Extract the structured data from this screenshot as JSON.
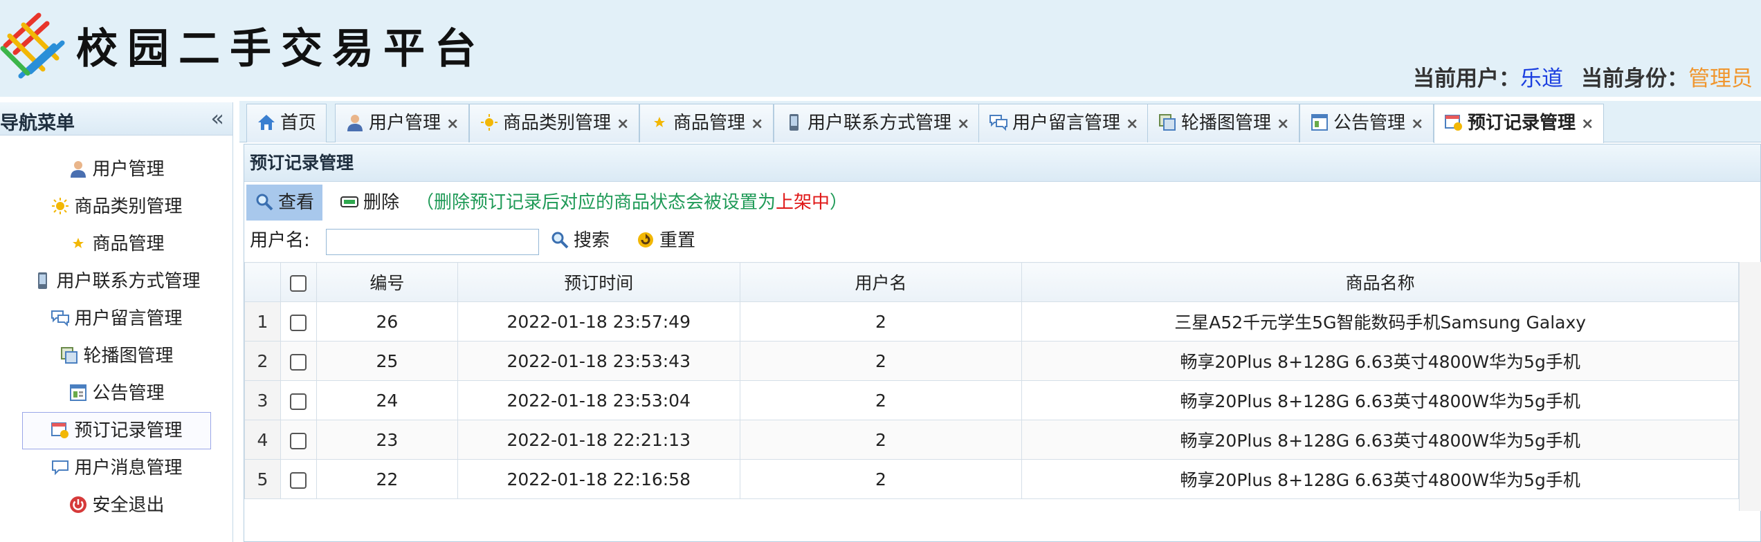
{
  "header": {
    "title": "校园二手交易平台",
    "user_label": "当前用户：",
    "user_value": "乐道",
    "role_label": "当前身份：",
    "role_value": "管理员",
    "logo_colors": [
      "#e8352b",
      "#f2b705",
      "#2a8fd8",
      "#3cb54a"
    ]
  },
  "sidebar": {
    "title": "导航菜单",
    "collapse_symbol": "«",
    "items": [
      {
        "label": "用户管理",
        "icon": "user-icon"
      },
      {
        "label": "商品类别管理",
        "icon": "sun-icon"
      },
      {
        "label": "商品管理",
        "icon": "star-icon"
      },
      {
        "label": "用户联系方式管理",
        "icon": "phone-icon"
      },
      {
        "label": "用户留言管理",
        "icon": "chat-icon"
      },
      {
        "label": "轮播图管理",
        "icon": "gallery-icon"
      },
      {
        "label": "公告管理",
        "icon": "notice-icon"
      },
      {
        "label": "预订记录管理",
        "icon": "booking-icon",
        "active": true
      },
      {
        "label": "用户消息管理",
        "icon": "message-icon"
      },
      {
        "label": "安全退出",
        "icon": "power-icon"
      }
    ]
  },
  "tabs": [
    {
      "label": "首页",
      "icon": "home-icon",
      "closable": false
    },
    {
      "label": "用户管理",
      "icon": "user-icon",
      "closable": true
    },
    {
      "label": "商品类别管理",
      "icon": "sun-icon",
      "closable": true
    },
    {
      "label": "商品管理",
      "icon": "star-icon",
      "closable": true
    },
    {
      "label": "用户联系方式管理",
      "icon": "phone-icon",
      "closable": true
    },
    {
      "label": "用户留言管理",
      "icon": "chat-icon",
      "closable": true
    },
    {
      "label": "轮播图管理",
      "icon": "gallery-icon",
      "closable": true
    },
    {
      "label": "公告管理",
      "icon": "notice-icon",
      "closable": true
    },
    {
      "label": "预订记录管理",
      "icon": "booking-icon",
      "closable": true,
      "active": true
    }
  ],
  "tab_close_symbol": "×",
  "panel": {
    "title": "预订记录管理",
    "toolbar": {
      "view_label": "查看",
      "delete_label": "删除",
      "note_prefix": "（删除预订记录后对应的商品状态会被设置为",
      "note_highlight": "上架中",
      "note_suffix": "）"
    },
    "search": {
      "label": "用户名:",
      "value": "",
      "placeholder": "",
      "search_label": "搜索",
      "reset_label": "重置"
    },
    "grid": {
      "columns": [
        "编号",
        "预订时间",
        "用户名",
        "商品名称"
      ],
      "rows": [
        {
          "num": "1",
          "id": "26",
          "time": "2022-01-18 23:57:49",
          "user": "2",
          "product": "三星A52千元学生5G智能数码手机Samsung Galaxy"
        },
        {
          "num": "2",
          "id": "25",
          "time": "2022-01-18 23:53:43",
          "user": "2",
          "product": "畅享20Plus 8+128G 6.63英寸4800W华为5g手机"
        },
        {
          "num": "3",
          "id": "24",
          "time": "2022-01-18 23:53:04",
          "user": "2",
          "product": "畅享20Plus 8+128G 6.63英寸4800W华为5g手机"
        },
        {
          "num": "4",
          "id": "23",
          "time": "2022-01-18 22:21:13",
          "user": "2",
          "product": "畅享20Plus 8+128G 6.63英寸4800W华为5g手机"
        },
        {
          "num": "5",
          "id": "22",
          "time": "2022-01-18 22:16:58",
          "user": "2",
          "product": "畅享20Plus 8+128G 6.63英寸4800W华为5g手机"
        }
      ]
    }
  },
  "colors": {
    "header_bg": "#e2f0f8",
    "accent_user": "#1a3ee0",
    "accent_role": "#f0962e",
    "note_green": "#1f9a57",
    "note_red": "#e01818",
    "active_button": "#a8c8ec"
  }
}
